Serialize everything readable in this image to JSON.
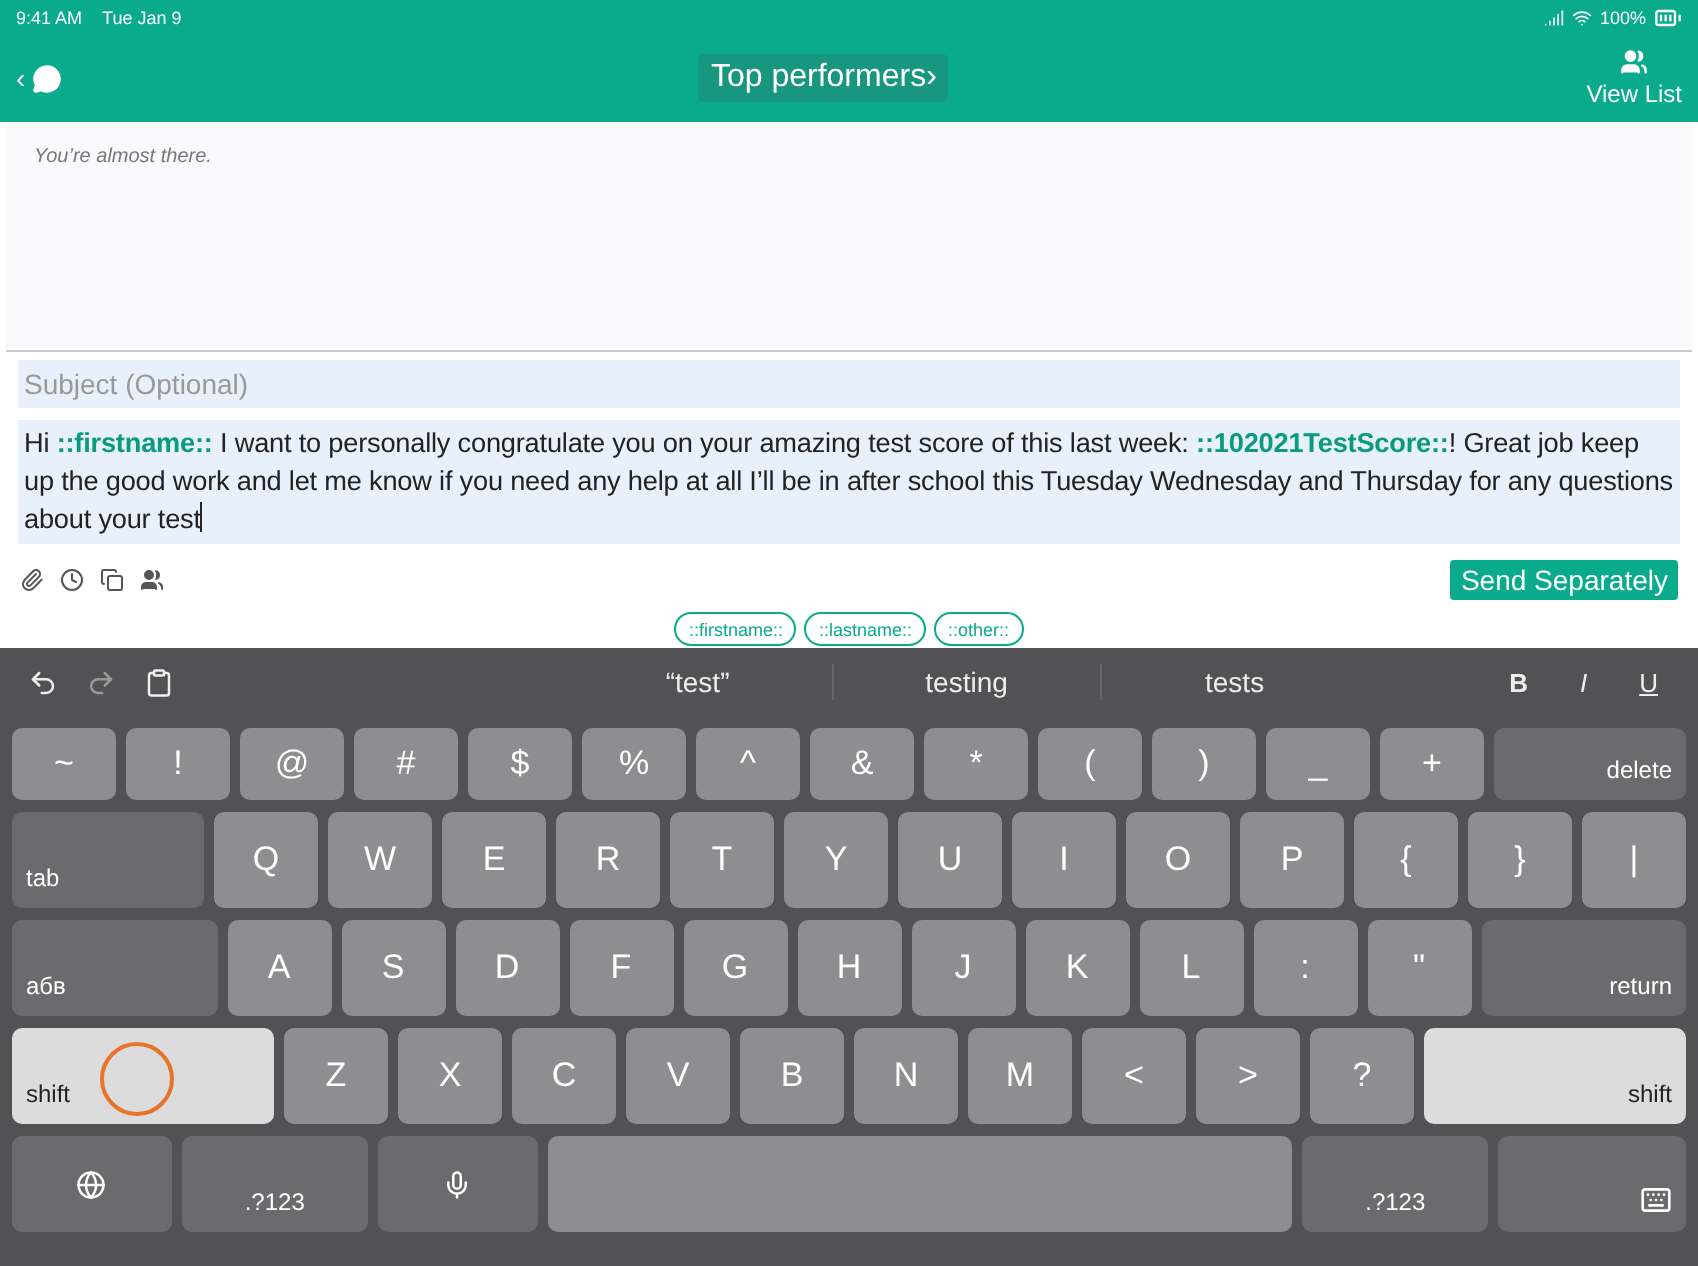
{
  "status_bar": {
    "time": "9:41 AM",
    "date": "Tue Jan 9",
    "battery": "100%"
  },
  "nav": {
    "title": "Top performers",
    "title_chevron": "›",
    "back": "‹",
    "right_label": "View List"
  },
  "hint": "You’re almost there.",
  "compose": {
    "subject_placeholder": "Subject (Optional)",
    "body": "Hi **::firstname::** I want to personally congratulate you on your amazing test score of this last week: **::102021TestScore::**! Great job keep up the good work and let me know if you need any help at all I’ll be in after school this Tuesday Wednesday and Thursday for any questions about your test",
    "send": "Send Separately"
  },
  "chips": [
    "::firstname::",
    "::lastname::",
    "::other::"
  ],
  "keyboard": {
    "suggestions": [
      "“test”",
      "testing",
      "tests"
    ],
    "format": [
      "B",
      "I",
      "U"
    ],
    "rows": [
      {
        "keys": [
          "~",
          "!",
          "@",
          "#",
          "$",
          "%",
          "^",
          "&",
          "*",
          "(",
          ")",
          "_",
          "+"
        ],
        "right_key": {
          "kind": "function",
          "label": "delete"
        }
      },
      {
        "left_key": {
          "kind": "function",
          "label": "tab"
        },
        "keys": [
          "Q",
          "W",
          "E",
          "R",
          "T",
          "Y",
          "U",
          "I",
          "O",
          "P",
          "{",
          "}",
          "|"
        ]
      },
      {
        "left_key": {
          "kind": "function",
          "label": "абв"
        },
        "keys": [
          "A",
          "S",
          "D",
          "F",
          "G",
          "H",
          "J",
          "K",
          "L",
          ":",
          "\""
        ],
        "right_key": {
          "kind": "function",
          "label": "return"
        }
      },
      {
        "left_key": {
          "kind": "shift",
          "label": "shift",
          "on": true
        },
        "keys": [
          "Z",
          "X",
          "C",
          "V",
          "B",
          "N",
          "M",
          "<",
          ">",
          "?"
        ],
        "right_key": {
          "kind": "shift",
          "label": "shift",
          "on": true
        }
      }
    ],
    "bottom_row": [
      {
        "kind": "globe"
      },
      {
        "kind": "mode",
        "label": ".?123"
      },
      {
        "kind": "mic"
      },
      {
        "kind": "space"
      },
      {
        "kind": "mode",
        "label": ".?123"
      },
      {
        "kind": "dismiss"
      }
    ]
  }
}
